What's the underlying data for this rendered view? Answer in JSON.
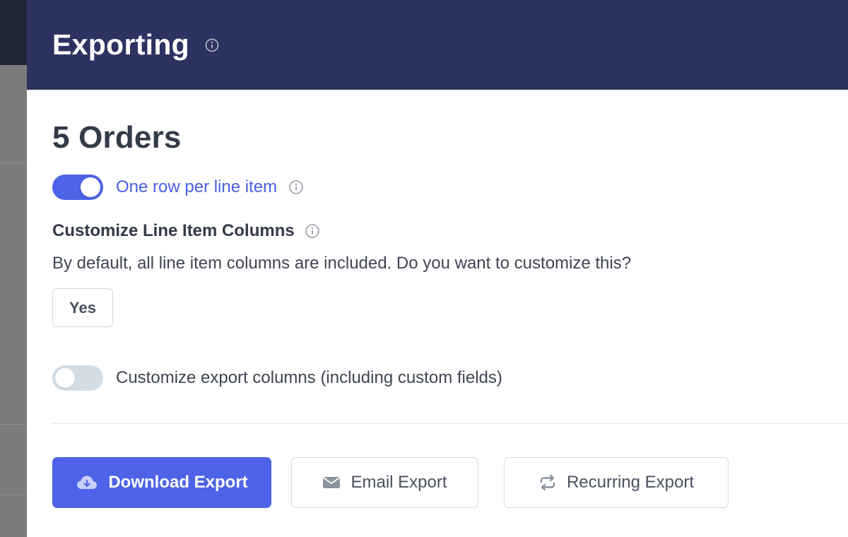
{
  "modal": {
    "title": "Exporting",
    "orders_title": "5 Orders",
    "line_item_toggle": {
      "label": "One row per line item",
      "enabled": true
    },
    "customize_line_items": {
      "heading": "Customize Line Item Columns",
      "description": "By default, all line item columns are included. Do you want to customize this?",
      "yes_label": "Yes"
    },
    "export_columns_toggle": {
      "label": "Customize export columns (including custom fields)",
      "enabled": false
    },
    "actions": {
      "download_label": "Download Export",
      "email_label": "Email Export",
      "recurring_label": "Recurring Export"
    }
  },
  "icons": {
    "title_info": "info-circle-icon",
    "toggle_info": "info-circle-icon",
    "heading_info": "info-circle-icon",
    "download": "cloud-download-icon",
    "email": "envelope-icon",
    "recurring": "repeat-icon"
  },
  "colors": {
    "header_bg": "#2d3360",
    "accent": "#4f63e8",
    "text_dark": "#333a48"
  }
}
